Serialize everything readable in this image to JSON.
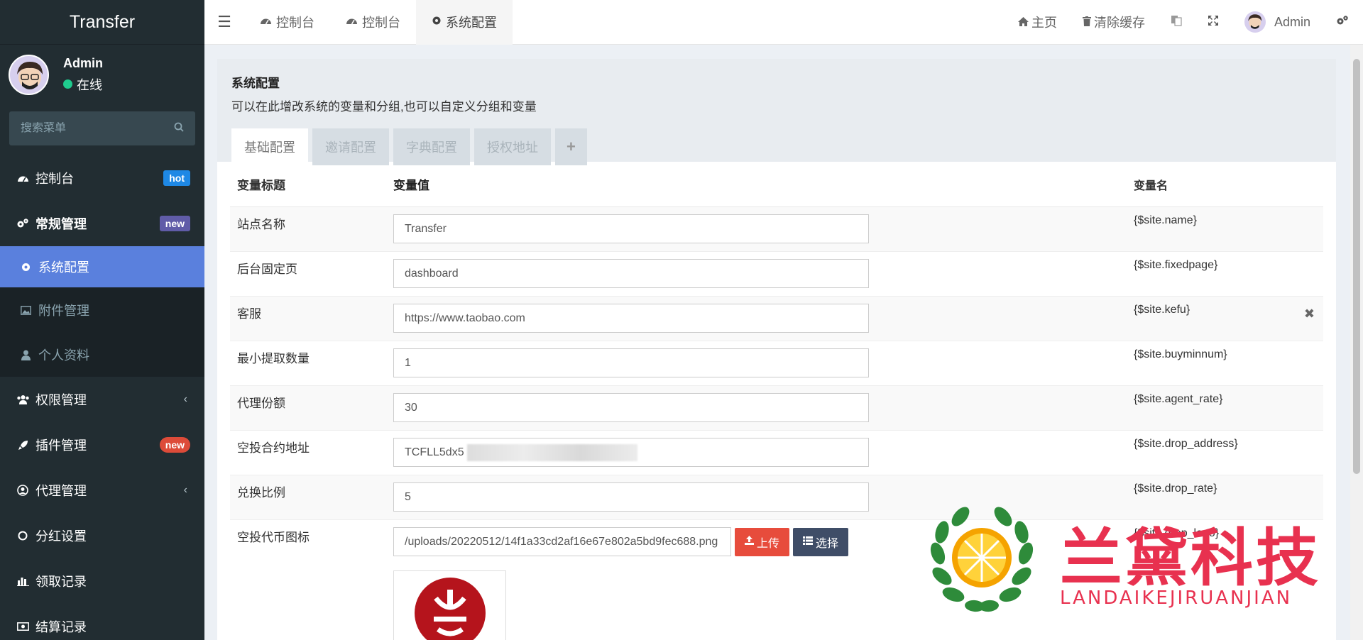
{
  "brand": "Transfer",
  "user": {
    "name": "Admin",
    "status": "在线"
  },
  "search": {
    "placeholder": "搜索菜单"
  },
  "nav": [
    {
      "label": "控制台",
      "badge": "hot",
      "icon": "dashboard-icon"
    },
    {
      "label": "常规管理",
      "badge": "new",
      "icon": "cogs-icon"
    },
    {
      "label": "系统配置",
      "icon": "gear-icon",
      "active": true
    },
    {
      "label": "附件管理",
      "icon": "image-icon"
    },
    {
      "label": "个人资料",
      "icon": "user-icon"
    },
    {
      "label": "权限管理",
      "icon": "group-icon"
    },
    {
      "label": "插件管理",
      "badge": "new",
      "icon": "rocket-icon"
    },
    {
      "label": "代理管理",
      "icon": "user-circle-icon"
    },
    {
      "label": "分红设置",
      "icon": "circle-icon"
    },
    {
      "label": "领取记录",
      "icon": "chart-icon"
    },
    {
      "label": "结算记录",
      "icon": "money-icon"
    }
  ],
  "header": {
    "tabs": [
      "控制台",
      "控制台",
      "系统配置"
    ],
    "home": "主页",
    "clear_cache": "清除缓存",
    "admin": "Admin"
  },
  "content": {
    "title": "系统配置",
    "subtitle": "可以在此增改系统的变量和分组,也可以自定义分组和变量",
    "tabs": [
      "基础配置",
      "邀请配置",
      "字典配置",
      "授权地址",
      "+"
    ],
    "columns": [
      "变量标题",
      "变量值",
      "变量名"
    ],
    "rows": [
      {
        "title": "站点名称",
        "value": "Transfer",
        "name": "{$site.name}"
      },
      {
        "title": "后台固定页",
        "value": "dashboard",
        "name": "{$site.fixedpage}"
      },
      {
        "title": "客服",
        "value": "https://www.taobao.com",
        "name": "{$site.kefu}"
      },
      {
        "title": "最小提取数量",
        "value": "1",
        "name": "{$site.buyminnum}"
      },
      {
        "title": "代理份额",
        "value": "30",
        "name": "{$site.agent_rate}"
      },
      {
        "title": "空投合约地址",
        "value": "TCFLL5dx5",
        "name": "{$site.drop_address}"
      },
      {
        "title": "兑换比例",
        "value": "5",
        "name": "{$site.drop_rate}"
      },
      {
        "title": "空投代币图标",
        "value": "/uploads/20220512/14f1a33cd2af16e67e802a5bd9fec688.png",
        "name": "{$site.drop_logo}"
      }
    ],
    "upload_label": "上传",
    "choose_label": "选择"
  },
  "watermark": {
    "cn": "兰黛科技",
    "en": "LANDAIKEJIRUANJIAN"
  },
  "colors": {
    "sidebar": "#222d32",
    "active": "#5b7ddb",
    "upload": "#e74c3c",
    "choose": "#3f4d67",
    "watermark": "#e8314f"
  }
}
